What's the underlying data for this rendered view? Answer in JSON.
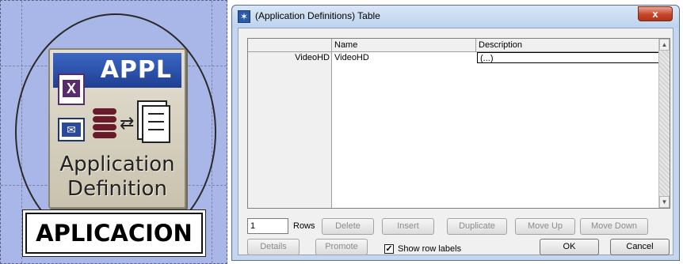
{
  "node": {
    "banner": "APPL",
    "caption_line1": "Application",
    "caption_line2": "Definition",
    "label": "APLICACION",
    "icons": [
      "spreadsheet-icon",
      "mail-icon",
      "database-icon",
      "exchange-arrows-icon",
      "documents-icon"
    ]
  },
  "dialog": {
    "title": "(Application Definitions) Table",
    "close_label": "x",
    "table": {
      "columns": [
        "Name",
        "Description"
      ],
      "rows": [
        {
          "label": "VideoHD",
          "name": "VideoHD",
          "description": "(...)"
        }
      ]
    },
    "rows_count": "1",
    "rows_label": "Rows",
    "buttons": {
      "delete": "Delete",
      "insert": "Insert",
      "duplicate": "Duplicate",
      "move_up": "Move Up",
      "move_down": "Move Down",
      "details": "Details",
      "promote": "Promote",
      "ok": "OK",
      "cancel": "Cancel"
    },
    "show_row_labels": {
      "label": "Show row labels",
      "checked": true
    }
  },
  "colors": {
    "canvas_background": "#a9b7e8",
    "banner_blue": "#1f3f93",
    "window_frame": "#c5d7ee",
    "close_red": "#c7452b"
  }
}
